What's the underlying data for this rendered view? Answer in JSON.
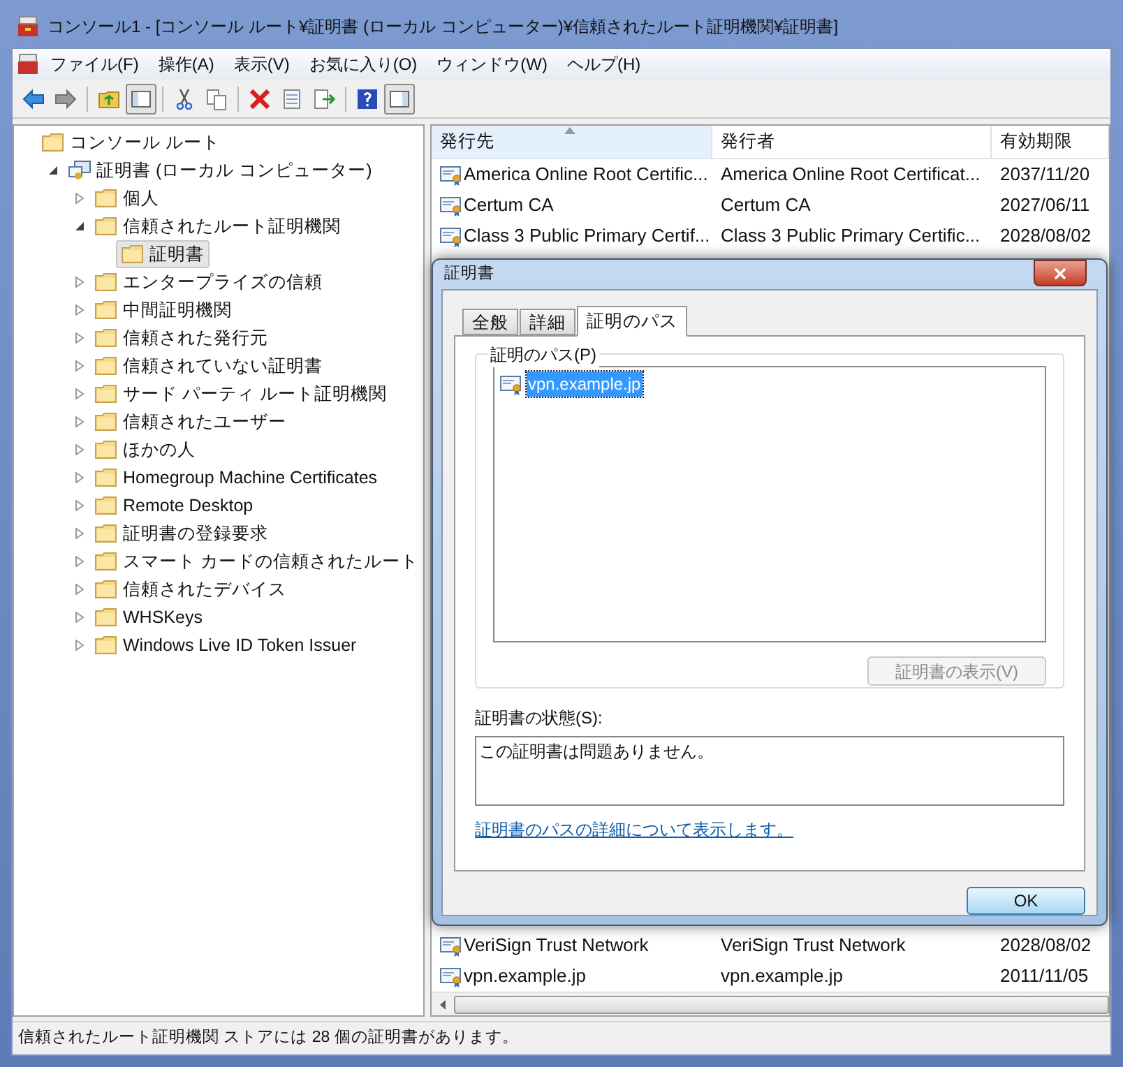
{
  "window": {
    "title": "コンソール1 - [コンソール ルート¥証明書 (ローカル コンピューター)¥信頼されたルート証明機関¥証明書]"
  },
  "menu": [
    "ファイル(F)",
    "操作(A)",
    "表示(V)",
    "お気に入り(O)",
    "ウィンドウ(W)",
    "ヘルプ(H)"
  ],
  "tree": [
    {
      "label": "コンソール ルート",
      "kind": "folder",
      "selected": false,
      "children": [
        {
          "label": "証明書 (ローカル コンピューター)",
          "kind": "cert-store",
          "expanded": true,
          "selected": false,
          "children": [
            {
              "label": "個人",
              "kind": "folder",
              "expanded": false,
              "selected": false
            },
            {
              "label": "信頼されたルート証明機関",
              "kind": "folder",
              "expanded": true,
              "selected": false,
              "children": [
                {
                  "label": "証明書",
                  "kind": "folder",
                  "selected": true
                }
              ]
            },
            {
              "label": "エンタープライズの信頼",
              "kind": "folder",
              "expanded": false,
              "selected": false
            },
            {
              "label": "中間証明機関",
              "kind": "folder",
              "expanded": false,
              "selected": false
            },
            {
              "label": "信頼された発行元",
              "kind": "folder",
              "expanded": false,
              "selected": false
            },
            {
              "label": "信頼されていない証明書",
              "kind": "folder",
              "expanded": false,
              "selected": false
            },
            {
              "label": "サード パーティ ルート証明機関",
              "kind": "folder",
              "expanded": false,
              "selected": false
            },
            {
              "label": "信頼されたユーザー",
              "kind": "folder",
              "expanded": false,
              "selected": false
            },
            {
              "label": "ほかの人",
              "kind": "folder",
              "expanded": false,
              "selected": false
            },
            {
              "label": "Homegroup Machine Certificates",
              "kind": "folder",
              "expanded": false,
              "selected": false
            },
            {
              "label": "Remote Desktop",
              "kind": "folder",
              "expanded": false,
              "selected": false
            },
            {
              "label": "証明書の登録要求",
              "kind": "folder",
              "expanded": false,
              "selected": false
            },
            {
              "label": "スマート カードの信頼されたルート",
              "kind": "folder",
              "expanded": false,
              "selected": false
            },
            {
              "label": "信頼されたデバイス",
              "kind": "folder",
              "expanded": false,
              "selected": false
            },
            {
              "label": "WHSKeys",
              "kind": "folder",
              "expanded": false,
              "selected": false
            },
            {
              "label": "Windows Live ID Token Issuer",
              "kind": "folder",
              "expanded": false,
              "selected": false
            }
          ]
        }
      ]
    }
  ],
  "table": {
    "columns": [
      {
        "label": "発行先",
        "sorted": true
      },
      {
        "label": "発行者",
        "sorted": false
      },
      {
        "label": "有効期限",
        "sorted": false
      }
    ],
    "top_rows": [
      [
        "America Online Root Certific...",
        "America Online Root Certificat...",
        "2037/11/20"
      ],
      [
        "Certum CA",
        "Certum CA",
        "2027/06/11"
      ],
      [
        "Class 3 Public Primary Certif...",
        "Class 3 Public Primary Certific...",
        "2028/08/02"
      ]
    ],
    "bottom_rows": [
      [
        "VeriSign Trust Network",
        "VeriSign Trust Network",
        "2028/08/02"
      ],
      [
        "vpn.example.jp",
        "vpn.example.jp",
        "2011/11/05"
      ]
    ]
  },
  "dialog": {
    "title": "証明書",
    "tabs": [
      {
        "label": "全般",
        "selected": false
      },
      {
        "label": "詳細",
        "selected": false
      },
      {
        "label": "証明のパス",
        "selected": true
      }
    ],
    "path_group": {
      "label": "証明のパス(P)",
      "items": [
        {
          "label": "vpn.example.jp",
          "selected": true
        }
      ]
    },
    "view_button": {
      "label": "証明書の表示(V)",
      "disabled": true
    },
    "status_label": "証明書の状態(S):",
    "status_value": "この証明書は問題ありません。",
    "link": "証明書のパスの詳細について表示します。",
    "ok_button": "OK"
  },
  "status_bar": "信頼されたルート証明機関 ストアには 28 個の証明書があります。"
}
